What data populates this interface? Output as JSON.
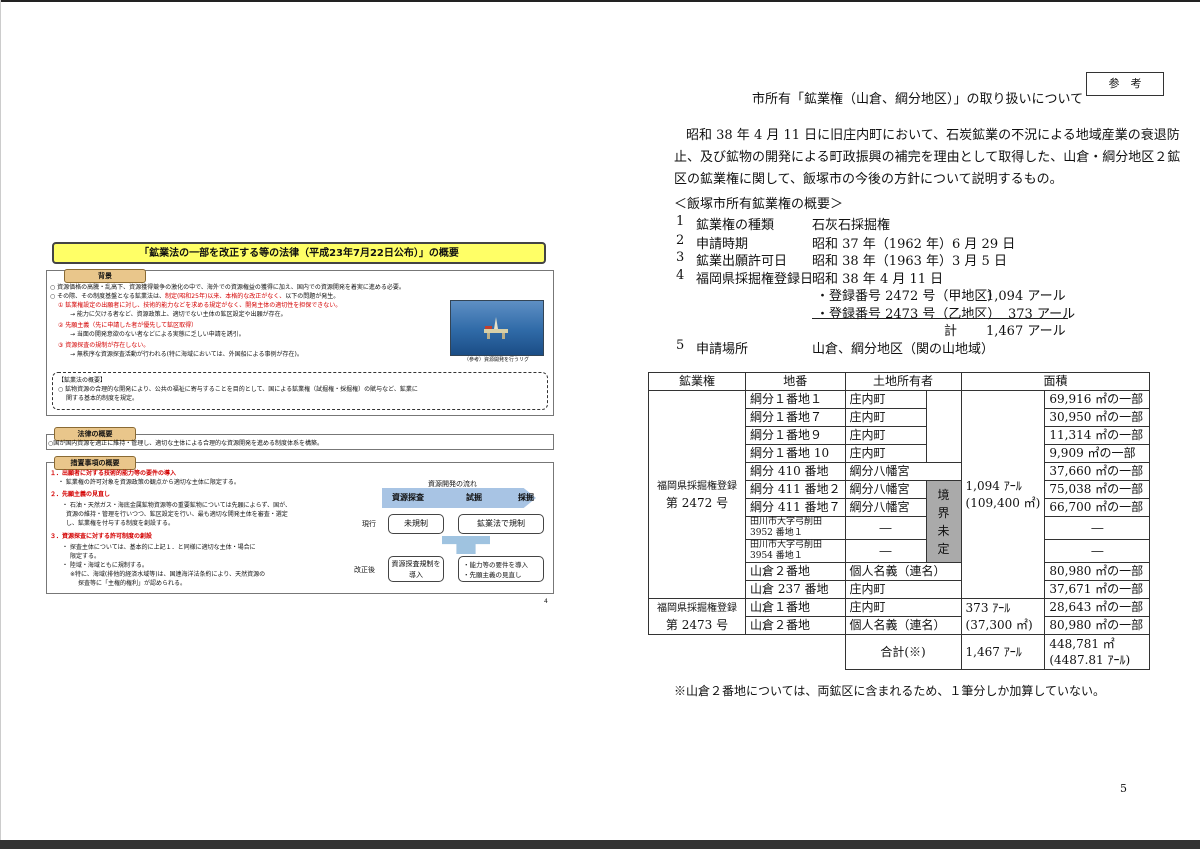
{
  "slide": {
    "title": "「鉱業法の一部を改正する等の法律（平成23年7月22日公布）」の概要",
    "background_tag": "背景",
    "bg_line1": "○ 資源価格の高騰・乱高下、資源獲得競争の激化の中で、海外での資源権益の獲得に加え、国内での資源開発を着実に進める必要。",
    "bg_line2a": "○ その際、その制度基盤となる鉱業法は、",
    "bg_line2b": "制定(昭和25年)以来、本格的な改正がなく、",
    "bg_line2c": "以下の問題が発生。",
    "bg_p1": "① 鉱業権設定の出願者に対し、技術的能力などを求める規定がなく、開発主体の適切性を担保できない。",
    "bg_p1s": "→ 能力に欠ける者など、資源政策上、適切でない主体の鉱区設定や出願が存在。",
    "bg_p2": "② 先願主義（先に申請した者が優先して鉱区取得）",
    "bg_p2s": "→ 当面の開発意欲のない者などによる実態に乏しい申請を誘引。",
    "bg_p3": "③ 資源探査の規制が存在しない。",
    "bg_p3s": "→ 無秩序な資源探査活動が行われる(特に海域においては、外国船による事例が存在)。",
    "photo_caption": "（参考）資源開発を行うリグ",
    "law_heading": "【鉱業法の概要】",
    "law_line1": "○ 鉱物資源の合理的な開発により、公共の福祉に寄与することを目的として、国による鉱業権（試掘権・採掘権）の賦与など、鉱業に",
    "law_line2": "関する基本的制度を規定。",
    "summary_tag": "法律の概要",
    "summary_text": "○国が国内資源を適正に維持・管理し、適切な主体による合理的な資源開発を進める制度体系を構築。",
    "measures_tag": "措置事項の概要",
    "m1": "１．出願者に対する技術的能力等の要件の導入",
    "m1s": "・ 鉱業権の許可対象を資源政策の観点から適切な主体に限定する。",
    "m2": "２．先願主義の見直し",
    "m2s1": "・ 石油・天然ガス・海底金属鉱物資源等の重要鉱物については先願によらず、国が、",
    "m2s2": "資源の維持・管理を行いつつ、鉱区設定を行い、最も適切な開発主体を審査・選定",
    "m2s3": "し、鉱業権を付与する制度を創設する。",
    "m3": "３．資源探査に対する許可制度の創設",
    "m3s1": "・ 探査主体については、基本的に上記１．と同様に適切な主体・場合に",
    "m3s2": "限定する。",
    "m3s3": "・ 陸域・海域ともに規制する。",
    "m3s4": "※特に、海域(排他的経済水域等)は、国連海洋法条約により、天然資源の",
    "m3s5": "探査等に「主権的権利」が認められる。",
    "flow_title": "資源開発の流れ",
    "flow_stage1": "資源探査",
    "flow_stage2": "試掘",
    "flow_stage3": "採掘",
    "current_label": "現行",
    "current_box1": "未規制",
    "current_box2": "鉱業法で規制",
    "after_label": "改正後",
    "after_box1": "資源探査規制を導入",
    "after_box2a": "・能力等の要件を導入",
    "after_box2b": "・先願主義の見直し",
    "page": "4"
  },
  "doc": {
    "ref_label": "参　考",
    "title": "市所有「鉱業権（山倉、綱分地区）」の取り扱いについて",
    "intro1": "昭和 38 年 4 月 11 日に旧庄内町において、石炭鉱業の不況による地域産業の衰退防",
    "intro2": "止、及び鉱物の開発による町政振興の補完を理由として取得した、山倉・綱分地区２鉱",
    "intro3": "区の鉱業権に関して、飯塚市の今後の方針について説明するもの。",
    "overview_heading": "＜飯塚市所有鉱業権の概要＞",
    "overview": [
      {
        "num": "1",
        "label": "鉱業権の種類",
        "value": "石灰石採掘権"
      },
      {
        "num": "2",
        "label": "申請時期",
        "value": "昭和 37 年（1962 年）6 月 29 日"
      },
      {
        "num": "3",
        "label": "鉱業出願許可日",
        "value": "昭和 38 年（1963 年）3 月 5 日"
      },
      {
        "num": "4",
        "label": "福岡県採掘権登録日",
        "value": "昭和 38 年 4 月 11 日"
      }
    ],
    "reg1_label": "・登録番号 2472 号（甲地区）",
    "reg1_value": "1,094 アール",
    "reg2_label": "・登録番号 2473 号（乙地区）",
    "reg2_value": "373 アール",
    "sum_label": "計",
    "sum_value": "1,467 アール",
    "item5_num": "5",
    "item5_label": "申請場所",
    "item5_value": "山倉、綱分地区（関の山地域）",
    "table": {
      "headers": [
        "鉱業権",
        "地番",
        "土地所有者",
        "面積"
      ],
      "group1_label1": "福岡県採掘権登録",
      "group1_label2": "第 2472 号",
      "group1_area1": "1,094 ｱｰﾙ",
      "group1_area2": "(109,400 ㎡)",
      "boundary": "境界未定",
      "rows1": [
        {
          "lot": "綱分１番地１",
          "owner": "庄内町",
          "area": "69,916 ㎡の一部"
        },
        {
          "lot": "綱分１番地７",
          "owner": "庄内町",
          "area": "30,950 ㎡の一部"
        },
        {
          "lot": "綱分１番地９",
          "owner": "庄内町",
          "area": "11,314 ㎡の一部"
        },
        {
          "lot": "綱分１番地 10",
          "owner": "庄内町",
          "area": "9,909 ㎡の一部"
        },
        {
          "lot": "綱分 410 番地",
          "owner": "綱分八幡宮",
          "area": "37,660 ㎡の一部"
        },
        {
          "lot": "綱分 411 番地２",
          "owner": "綱分八幡宮",
          "area": "75,038 ㎡の一部"
        },
        {
          "lot": "綱分 411 番地７",
          "owner": "綱分八幡宮",
          "area": "66,700 ㎡の一部"
        },
        {
          "lot": "田川市大字弓削田 3952 番地１",
          "owner": "―",
          "area": "―"
        },
        {
          "lot": "田川市大字弓削田 3954 番地１",
          "owner": "―",
          "area": "―"
        },
        {
          "lot": "山倉２番地",
          "owner": "個人名義（連名）",
          "area": "80,980 ㎡の一部"
        },
        {
          "lot": "山倉 237 番地",
          "owner": "庄内町",
          "area": "37,671 ㎡の一部"
        }
      ],
      "group2_label1": "福岡県採掘権登録",
      "group2_label2": "第 2473 号",
      "group2_area1": "373 ｱｰﾙ",
      "group2_area2": "(37,300 ㎡)",
      "rows2": [
        {
          "lot": "山倉１番地",
          "owner": "庄内町",
          "area": "28,643 ㎡の一部"
        },
        {
          "lot": "山倉２番地",
          "owner": "個人名義（連名）",
          "area": "80,980 ㎡の一部"
        }
      ],
      "total_label": "合計(※)",
      "total_area": "1,467 ｱｰﾙ",
      "total_m2a": "448,781 ㎡",
      "total_m2b": "(4487.81 ｱｰﾙ)"
    },
    "footnote": "※山倉２番地については、両鉱区に含まれるため、１筆分しか加算していない。",
    "page": "5"
  }
}
